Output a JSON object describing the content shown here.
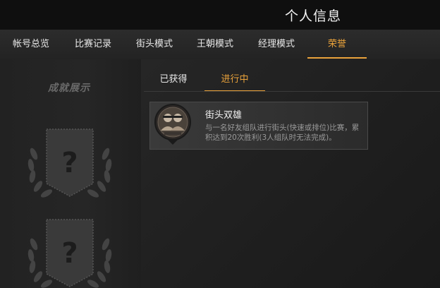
{
  "header": {
    "title": "个人信息"
  },
  "tabs": [
    {
      "label": "帐号总览",
      "active": false
    },
    {
      "label": "比赛记录",
      "active": false
    },
    {
      "label": "街头模式",
      "active": false
    },
    {
      "label": "王朝模式",
      "active": false
    },
    {
      "label": "经理模式",
      "active": false
    },
    {
      "label": "荣誉",
      "active": true
    }
  ],
  "showcase": {
    "title": "成就展示",
    "slots": [
      {
        "symbol": "?"
      },
      {
        "symbol": "?"
      }
    ]
  },
  "subtabs": [
    {
      "label": "已获得",
      "active": false
    },
    {
      "label": "进行中",
      "active": true
    }
  ],
  "achievements": [
    {
      "name": "街头双雄",
      "icon": "two-players-badge-icon",
      "description": "与一名好友组队进行街头(快速或排位)比赛，累积达到20次胜利(3人组队时无法完成)。"
    }
  ],
  "colors": {
    "accent": "#e9a23b",
    "background": "#1e1e1e",
    "card": "#353535"
  }
}
